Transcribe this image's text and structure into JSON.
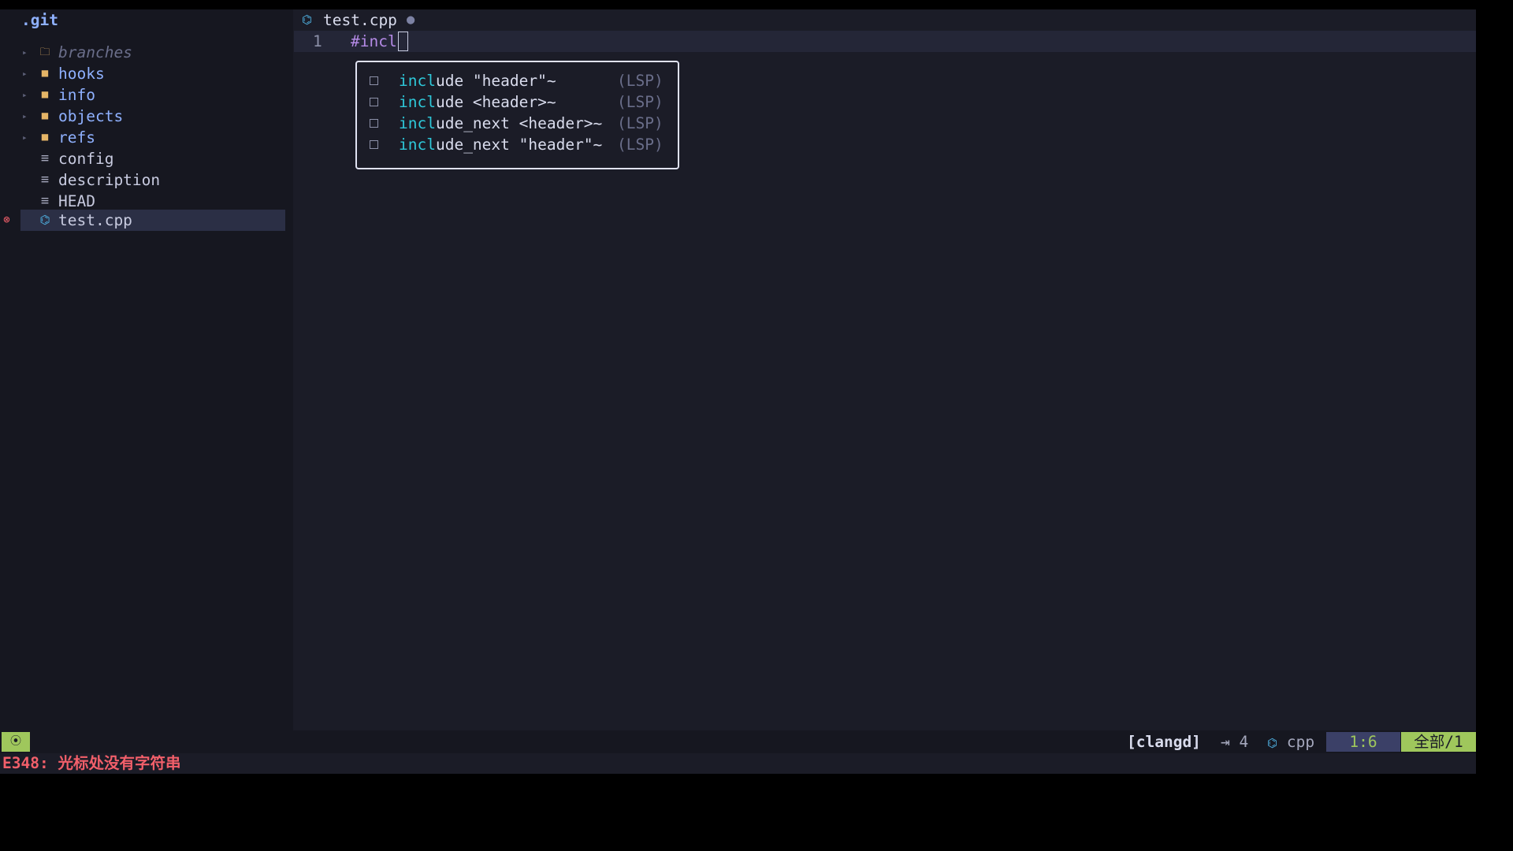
{
  "colors": {
    "background": "#1b1c27",
    "sidebar_background": "#161720",
    "selection": "#2b2f45",
    "folder": "#e5b567",
    "directory_name": "#8fb1ff",
    "completion_match": "#2ec8d9",
    "keyword_preproc": "#b48ae6",
    "mode_green": "#9fc75c",
    "error_red": "#f25f6a"
  },
  "file_tree": {
    "root": ".git",
    "items": [
      {
        "name": "branches",
        "type": "folder-empty",
        "icon": "folder-outline-icon",
        "glyph": "🗀"
      },
      {
        "name": "hooks",
        "type": "folder",
        "icon": "folder-icon",
        "glyph": "■"
      },
      {
        "name": "info",
        "type": "folder",
        "icon": "folder-icon",
        "glyph": "■"
      },
      {
        "name": "objects",
        "type": "folder",
        "icon": "folder-icon",
        "glyph": "■"
      },
      {
        "name": "refs",
        "type": "folder",
        "icon": "folder-icon",
        "glyph": "■"
      },
      {
        "name": "config",
        "type": "file",
        "icon": "file-lines-icon",
        "glyph": "≡"
      },
      {
        "name": "description",
        "type": "file",
        "icon": "file-lines-icon",
        "glyph": "≡"
      },
      {
        "name": "HEAD",
        "type": "file",
        "icon": "file-lines-icon",
        "glyph": "≡"
      },
      {
        "name": "test.cpp",
        "type": "cpp",
        "icon": "cpp-file-icon",
        "glyph": "⌬",
        "selected": true,
        "diagnostic": "error"
      }
    ],
    "caret_glyph": "▸",
    "error_glyph": "⊗"
  },
  "editor": {
    "tab": {
      "filename": "test.cpp",
      "icon_glyph": "⌬",
      "modified_glyph": "●"
    },
    "lines": [
      {
        "number": "1",
        "text": "#incl"
      }
    ]
  },
  "completion": {
    "items": [
      {
        "match": "incl",
        "rest": "ude \"header\"~",
        "source": "(LSP)"
      },
      {
        "match": "incl",
        "rest": "ude <header>~",
        "source": "(LSP)"
      },
      {
        "match": "incl",
        "rest": "ude_next <header>~",
        "source": "(LSP)"
      },
      {
        "match": "incl",
        "rest": "ude_next \"header\"~",
        "source": "(LSP)"
      }
    ]
  },
  "statusline": {
    "mode_glyph": "⦿",
    "lsp": "[clangd]",
    "indent_glyph": "⇥",
    "indent": "4",
    "filetype_glyph": "⌬",
    "filetype": "cpp",
    "position": "1:6",
    "percent": "全部/1"
  },
  "cmdline": {
    "message": "E348: 光标处没有字符串"
  }
}
